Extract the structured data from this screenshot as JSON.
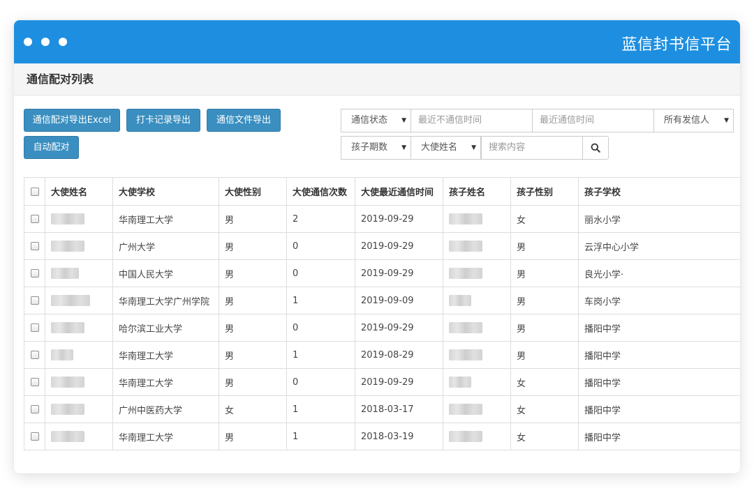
{
  "header": {
    "brand": "蓝信封书信平台"
  },
  "panel": {
    "title": "通信配对列表"
  },
  "toolbar": {
    "export_pairs": "通信配对导出Excel",
    "export_checkin": "打卡记录导出",
    "export_letters": "通信文件导出",
    "auto_pair": "自动配对"
  },
  "filters": {
    "status_select": "通信状态",
    "last_no_comm_placeholder": "最近不通信时间",
    "last_comm_placeholder": "最近通信时间",
    "sender_select": "所有发信人",
    "period_select": "孩子期数",
    "ambassador_select": "大使姓名",
    "search_placeholder": "搜索内容"
  },
  "table": {
    "headers": [
      "大使姓名",
      "大使学校",
      "大使性别",
      "大使通信次数",
      "大使最近通信时间",
      "孩子姓名",
      "孩子性别",
      "孩子学校"
    ],
    "rows": [
      {
        "school": "华南理工大学",
        "gender": "男",
        "count": "2",
        "last": "2019-09-29",
        "child_gender": "女",
        "child_school": "丽水小学"
      },
      {
        "school": "广州大学",
        "gender": "男",
        "count": "0",
        "last": "2019-09-29",
        "child_gender": "男",
        "child_school": "云浮中心小学"
      },
      {
        "school": "中国人民大学",
        "gender": "男",
        "count": "0",
        "last": "2019-09-29",
        "child_gender": "男",
        "child_school": "良光小学·"
      },
      {
        "school": "华南理工大学广州学院",
        "gender": "男",
        "count": "1",
        "last": "2019-09-09",
        "child_gender": "男",
        "child_school": "车岗小学"
      },
      {
        "school": "哈尔滨工业大学",
        "gender": "男",
        "count": "0",
        "last": "2019-09-29",
        "child_gender": "男",
        "child_school": "播阳中学"
      },
      {
        "school": "华南理工大学",
        "gender": "男",
        "count": "1",
        "last": "2019-08-29",
        "child_gender": "男",
        "child_school": "播阳中学"
      },
      {
        "school": "华南理工大学",
        "gender": "男",
        "count": "0",
        "last": "2019-09-29",
        "child_gender": "女",
        "child_school": "播阳中学"
      },
      {
        "school": "广州中医药大学",
        "gender": "女",
        "count": "1",
        "last": "2018-03-17",
        "child_gender": "女",
        "child_school": "播阳中学"
      },
      {
        "school": "华南理工大学",
        "gender": "男",
        "count": "1",
        "last": "2018-03-19",
        "child_gender": "女",
        "child_school": "播阳中学"
      }
    ]
  },
  "icons": {
    "search": "search-icon",
    "caret": "caret-down-icon"
  },
  "colors": {
    "titlebar": "#1e8fe0",
    "button": "#3a8fc0"
  }
}
